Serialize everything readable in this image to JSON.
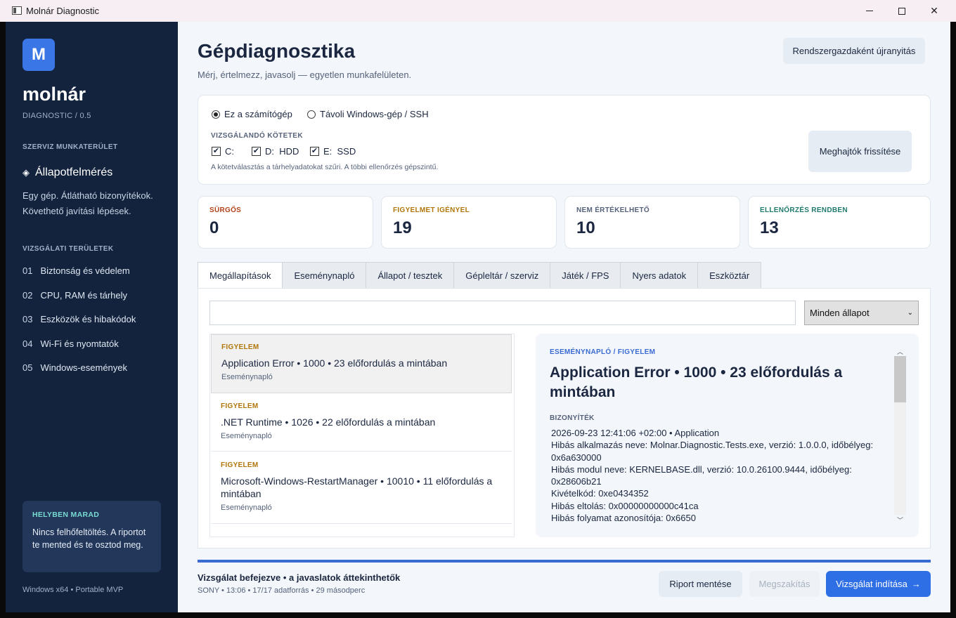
{
  "window": {
    "title": "Molnár Diagnostic"
  },
  "sidebar": {
    "logo_letter": "M",
    "brand_name": "molnár",
    "brand_sub": "DIAGNOSTIC / 0.5",
    "workspace_heading": "SZERVIZ MUNKATERÜLET",
    "active_item": "Állapotfelmérés",
    "description": "Egy gép. Átlátható bizonyítékok. Követhető javítási lépések.",
    "areas_heading": "VIZSGÁLATI TERÜLETEK",
    "areas": [
      {
        "num": "01",
        "label": "Biztonság és védelem"
      },
      {
        "num": "02",
        "label": "CPU, RAM és tárhely"
      },
      {
        "num": "03",
        "label": "Eszközök és hibakódok"
      },
      {
        "num": "04",
        "label": "Wi-Fi és nyomtatók"
      },
      {
        "num": "05",
        "label": "Windows-események"
      }
    ],
    "local_card": {
      "title": "HELYBEN MARAD",
      "text": "Nincs felhőfeltöltés. A riportot te mented és te osztod meg."
    },
    "footer": "Windows x64 • Portable MVP"
  },
  "header": {
    "title": "Gépdiagnosztika",
    "subtitle": "Mérj, értelmezz, javasolj — egyetlen munkafelületen.",
    "admin_button": "Rendszergazdaként újranyitás"
  },
  "target": {
    "radio_local": "Ez a számítógép",
    "radio_remote": "Távoli Windows-gép / SSH",
    "volumes_heading": "VIZSGÁLANDÓ KÖTETEK",
    "volumes": [
      {
        "label": "C:",
        "checked": true
      },
      {
        "label": "D:  HDD",
        "checked": true
      },
      {
        "label": "E:  SSD",
        "checked": true
      }
    ],
    "hint": "A kötetválasztás a tárhelyadatokat szűri. A többi ellenőrzés gépszintű.",
    "refresh_button": "Meghajtók frissítése"
  },
  "stats": [
    {
      "label": "SÜRGŐS",
      "value": "0",
      "color": "#b0421a"
    },
    {
      "label": "FIGYELMET IGÉNYEL",
      "value": "19",
      "color": "#b0760a"
    },
    {
      "label": "NEM ÉRTÉKELHETŐ",
      "value": "10",
      "color": "#55627a"
    },
    {
      "label": "ELLENŐRZÉS RENDBEN",
      "value": "13",
      "color": "#1f7a6b"
    }
  ],
  "tabs": [
    "Megállapítások",
    "Eseménynapló",
    "Állapot / tesztek",
    "Gépleltár / szerviz",
    "Játék / FPS",
    "Nyers adatok",
    "Eszköztár"
  ],
  "filter": {
    "search_value": "",
    "status_select": "Minden állapot"
  },
  "findings": [
    {
      "severity": "FIGYELEM",
      "title": "Application Error • 1000 • 23 előfordulás a mintában",
      "source": "Eseménynapló"
    },
    {
      "severity": "FIGYELEM",
      "title": ".NET Runtime • 1026 • 22 előfordulás a mintában",
      "source": "Eseménynapló"
    },
    {
      "severity": "FIGYELEM",
      "title": "Microsoft-Windows-RestartManager • 10010 • 11 előfordulás a mintában",
      "source": "Eseménynapló"
    }
  ],
  "detail": {
    "crumb": "ESEMÉNYNAPLÓ / FIGYELEM",
    "title": "Application Error • 1000 • 23 előfordulás a mintában",
    "evidence_heading": "BIZONYÍTÉK",
    "evidence_lines": [
      "2026-09-23 12:41:06 +02:00 • Application",
      "Hibás alkalmazás neve: Molnar.Diagnostic.Tests.exe, verzió: 1.0.0.0, időbélyeg: 0x6a630000",
      "Hibás modul neve: KERNELBASE.dll, verzió: 10.0.26100.9444, időbélyeg: 0x28606b21",
      "Kivételkód: 0xe0434352",
      "Hibás eltolás: 0x00000000000c41ca",
      "Hibás folyamat azonosítója: 0x6650"
    ]
  },
  "footer": {
    "progress": 1.0,
    "status": "Vizsgálat befejezve • a javaslatok áttekinthetők",
    "meta": "SONY • 13:06 • 17/17 adatforrás • 29 másodperc",
    "save_button": "Riport mentése",
    "cancel_button": "Megszakítás",
    "start_button": "Vizsgálat indítása",
    "start_icon": "→"
  }
}
